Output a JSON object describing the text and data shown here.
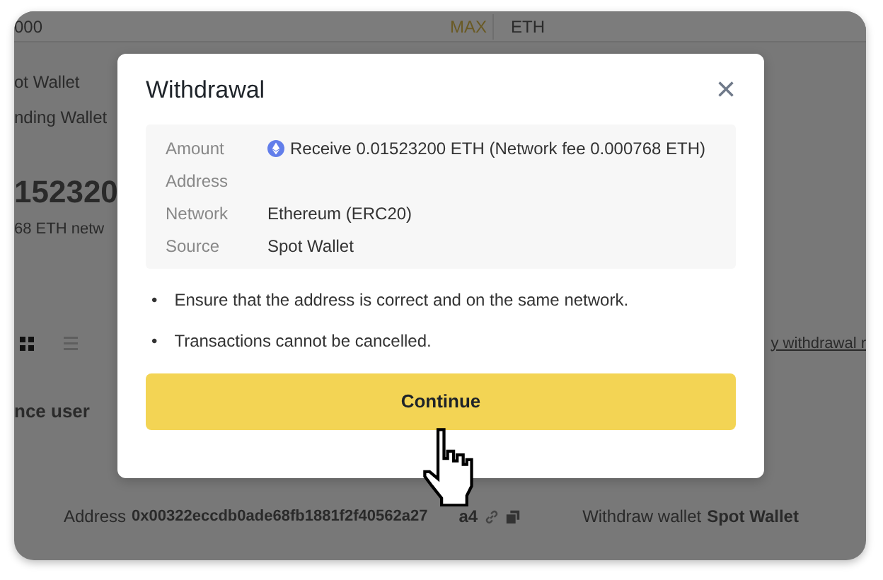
{
  "background": {
    "top_bar": {
      "amount": "000",
      "max": "MAX",
      "unit": "ETH"
    },
    "wallets": [
      "ot Wallet",
      "nding Wallet"
    ],
    "big_amount": "152320",
    "fee_note": "68 ETH netw",
    "views": [
      {
        "kind": "grid",
        "selected": true
      },
      {
        "kind": "list",
        "selected": false
      }
    ],
    "user_label": "nce user",
    "link": "y withdrawal r",
    "address_label": "Address",
    "address": "0x00322eccdb0ade68fb1881f2f40562a27",
    "address_tail": "a4",
    "withdraw_wallet_label": "Withdraw wallet",
    "withdraw_wallet": "Spot Wallet"
  },
  "modal": {
    "title": "Withdrawal",
    "close": "×",
    "rows": [
      {
        "label": "Amount",
        "kind": "coin",
        "value": "Receive 0.01523200 ETH (Network fee 0.000768 ETH)"
      },
      {
        "label": "Address",
        "kind": "text"
      },
      {
        "label": "Network",
        "kind": "text",
        "value": "Ethereum (ERC20)"
      },
      {
        "label": "Source",
        "kind": "text",
        "value": "Spot Wallet"
      }
    ],
    "bullet": "•",
    "notes": [
      "Ensure that the address is correct and on the same network.",
      "Transactions cannot be cancelled."
    ],
    "button": "Continue"
  }
}
